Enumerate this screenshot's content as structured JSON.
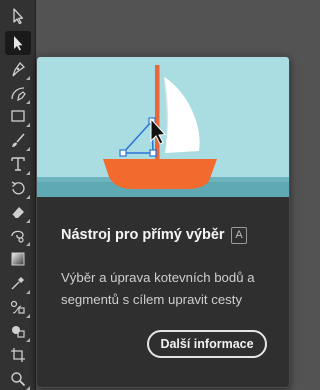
{
  "toolbar": {
    "tools": [
      {
        "icon": "selection-tool-icon",
        "active": false
      },
      {
        "icon": "direct-selection-tool-icon",
        "active": true
      },
      {
        "icon": "pen-tool-icon",
        "active": false
      },
      {
        "icon": "curvature-tool-icon",
        "active": false
      },
      {
        "icon": "rectangle-tool-icon",
        "active": false
      },
      {
        "icon": "paintbrush-tool-icon",
        "active": false
      },
      {
        "icon": "type-tool-icon",
        "active": false
      },
      {
        "icon": "rotate-tool-icon",
        "active": false
      },
      {
        "icon": "eraser-tool-icon",
        "active": false
      },
      {
        "icon": "warp-tool-icon",
        "active": false
      },
      {
        "icon": "gradient-tool-icon",
        "active": false
      },
      {
        "icon": "eyedropper-tool-icon",
        "active": false
      },
      {
        "icon": "blend-tool-icon",
        "active": false
      },
      {
        "icon": "shape-builder-tool-icon",
        "active": false
      },
      {
        "icon": "artboard-tool-icon",
        "active": false
      },
      {
        "icon": "zoom-tool-icon",
        "active": false
      }
    ]
  },
  "tooltip": {
    "title": "Nástroj pro přímý výběr",
    "shortcut": "A",
    "description": "Výběr a úprava kotevních bodů a segmentů s cílem upravit cesty",
    "button_label": "Další informace"
  },
  "colors": {
    "sky": "#a9dde2",
    "sea": "#6db4be",
    "hull": "#f26a2e",
    "mast": "#e8663a",
    "sail": "#ffffff",
    "selection": "#2b73d8"
  }
}
